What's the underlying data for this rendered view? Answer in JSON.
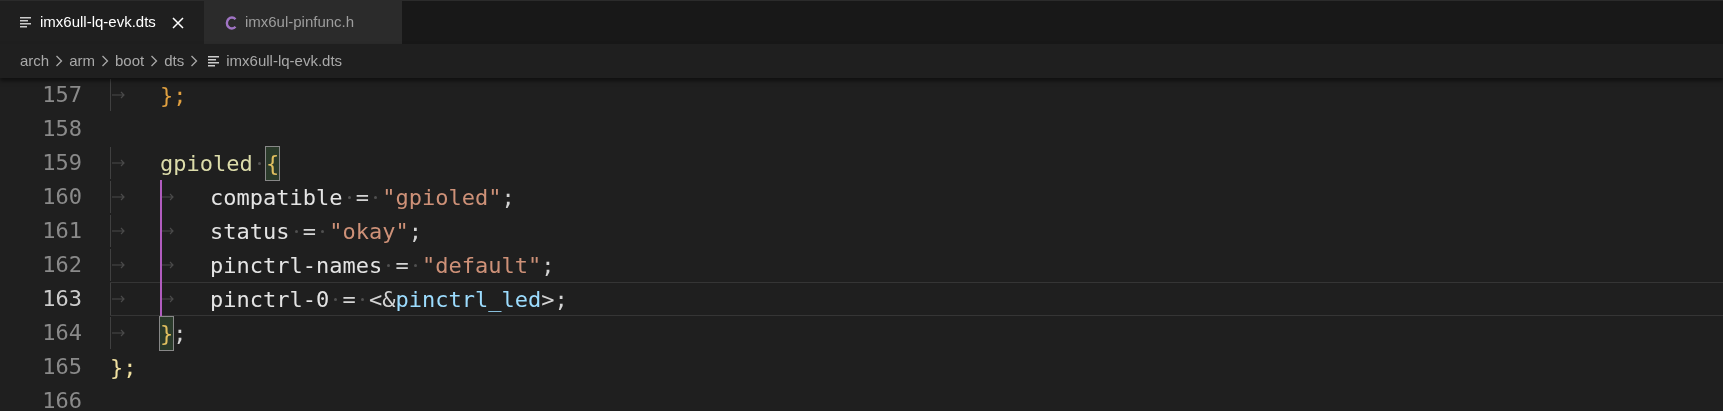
{
  "tabs": [
    {
      "label": "imx6ull-lq-evk.dts",
      "kind": "text",
      "selected": true,
      "closable": true
    },
    {
      "label": "imx6ul-pinfunc.h",
      "kind": "c",
      "selected": false,
      "closable": false
    }
  ],
  "breadcrumb": [
    {
      "label": "arch",
      "kind": "folder"
    },
    {
      "label": "arm",
      "kind": "folder"
    },
    {
      "label": "boot",
      "kind": "folder"
    },
    {
      "label": "dts",
      "kind": "folder"
    },
    {
      "label": "imx6ull-lq-evk.dts",
      "kind": "text"
    }
  ],
  "lines": [
    {
      "number": "157",
      "current": false,
      "guide": false,
      "tokens": [
        {
          "kind": "tab"
        },
        {
          "kind": "brace",
          "text": "};"
        }
      ]
    },
    {
      "number": "158",
      "current": false,
      "guide": false
    },
    {
      "number": "159",
      "current": false,
      "guide": false,
      "tokens": [
        {
          "kind": "tab"
        },
        {
          "kind": "node",
          "text": "gpioled"
        },
        {
          "kind": "space"
        },
        {
          "kind": "brace_match",
          "text": "{"
        }
      ]
    },
    {
      "number": "160",
      "current": false,
      "guide": true,
      "tokens": [
        {
          "kind": "tab"
        },
        {
          "kind": "tab"
        },
        {
          "kind": "prop",
          "text": "compatible"
        },
        {
          "kind": "space"
        },
        {
          "kind": "punct",
          "text": "="
        },
        {
          "kind": "space"
        },
        {
          "kind": "string",
          "text": "\"gpioled\""
        },
        {
          "kind": "punct",
          "text": ";"
        }
      ]
    },
    {
      "number": "161",
      "current": false,
      "guide": true,
      "tokens": [
        {
          "kind": "tab"
        },
        {
          "kind": "tab"
        },
        {
          "kind": "prop",
          "text": "status"
        },
        {
          "kind": "space"
        },
        {
          "kind": "punct",
          "text": "="
        },
        {
          "kind": "space"
        },
        {
          "kind": "string",
          "text": "\"okay\""
        },
        {
          "kind": "punct",
          "text": ";"
        }
      ]
    },
    {
      "number": "162",
      "current": false,
      "guide": true,
      "tokens": [
        {
          "kind": "tab"
        },
        {
          "kind": "tab"
        },
        {
          "kind": "prop",
          "text": "pinctrl-names"
        },
        {
          "kind": "space"
        },
        {
          "kind": "punct",
          "text": "="
        },
        {
          "kind": "space"
        },
        {
          "kind": "string",
          "text": "\"default\""
        },
        {
          "kind": "punct",
          "text": ";"
        }
      ]
    },
    {
      "number": "163",
      "current": true,
      "guide": true,
      "tokens": [
        {
          "kind": "tab"
        },
        {
          "kind": "tab"
        },
        {
          "kind": "prop",
          "text": "pinctrl-0"
        },
        {
          "kind": "space"
        },
        {
          "kind": "punct",
          "text": "="
        },
        {
          "kind": "space"
        },
        {
          "kind": "punct",
          "text": "<&"
        },
        {
          "kind": "ref",
          "text": "pinctrl_led"
        },
        {
          "kind": "punct",
          "text": ">;"
        }
      ]
    },
    {
      "number": "164",
      "current": false,
      "guide": false,
      "tokens": [
        {
          "kind": "tab"
        },
        {
          "kind": "brace_match",
          "text": "}"
        },
        {
          "kind": "punct",
          "text": ";"
        }
      ]
    },
    {
      "number": "165",
      "current": false,
      "guide": false,
      "tokens": [
        {
          "kind": "brace_outer",
          "text": "};"
        }
      ]
    },
    {
      "number": "166",
      "current": false,
      "guide": false
    }
  ]
}
